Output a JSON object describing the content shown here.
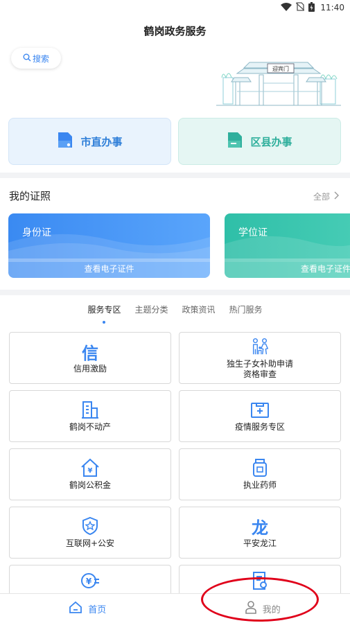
{
  "status_bar": {
    "time": "11:40",
    "icons": [
      "wifi-icon",
      "no-sim-icon",
      "battery-icon"
    ]
  },
  "app_title": "鹤岗政务服务",
  "search": {
    "label": "搜索"
  },
  "gate_sign": "迎宾门",
  "offices": [
    {
      "label": "市直办事",
      "color": "#2f7fd8"
    },
    {
      "label": "区县办事",
      "color": "#2faf9c"
    }
  ],
  "certificates": {
    "title": "我的证照",
    "all_label": "全部",
    "cards": [
      {
        "name": "身份证",
        "action": "查看电子证件"
      },
      {
        "name": "学位证",
        "action": "查看电子证件"
      }
    ]
  },
  "tabs": [
    {
      "label": "服务专区",
      "active": true
    },
    {
      "label": "主题分类",
      "active": false
    },
    {
      "label": "政策资讯",
      "active": false
    },
    {
      "label": "热门服务",
      "active": false
    }
  ],
  "services": [
    {
      "label": "信用激励",
      "icon": "credit-icon",
      "glyph": "信"
    },
    {
      "label": "独生子女补助申请\n资格审查",
      "icon": "family-icon"
    },
    {
      "label": "鹤岗不动产",
      "icon": "building-icon"
    },
    {
      "label": "疫情服务专区",
      "icon": "medical-box-icon"
    },
    {
      "label": "鹤岗公积金",
      "icon": "house-fund-icon"
    },
    {
      "label": "执业药师",
      "icon": "medicine-bottle-icon"
    },
    {
      "label": "互联网+公安",
      "icon": "police-badge-icon"
    },
    {
      "label": "平安龙江",
      "icon": "dragon-icon",
      "glyph": "龙"
    },
    {
      "label": "",
      "icon": "finance-icon"
    },
    {
      "label": "",
      "icon": "document-icon"
    }
  ],
  "tabbar": [
    {
      "label": "首页",
      "icon": "home-icon",
      "active": true
    },
    {
      "label": "我的",
      "icon": "user-icon",
      "active": false
    }
  ],
  "accent_color": "#3a86f0",
  "annotation_color": "#e0001a"
}
